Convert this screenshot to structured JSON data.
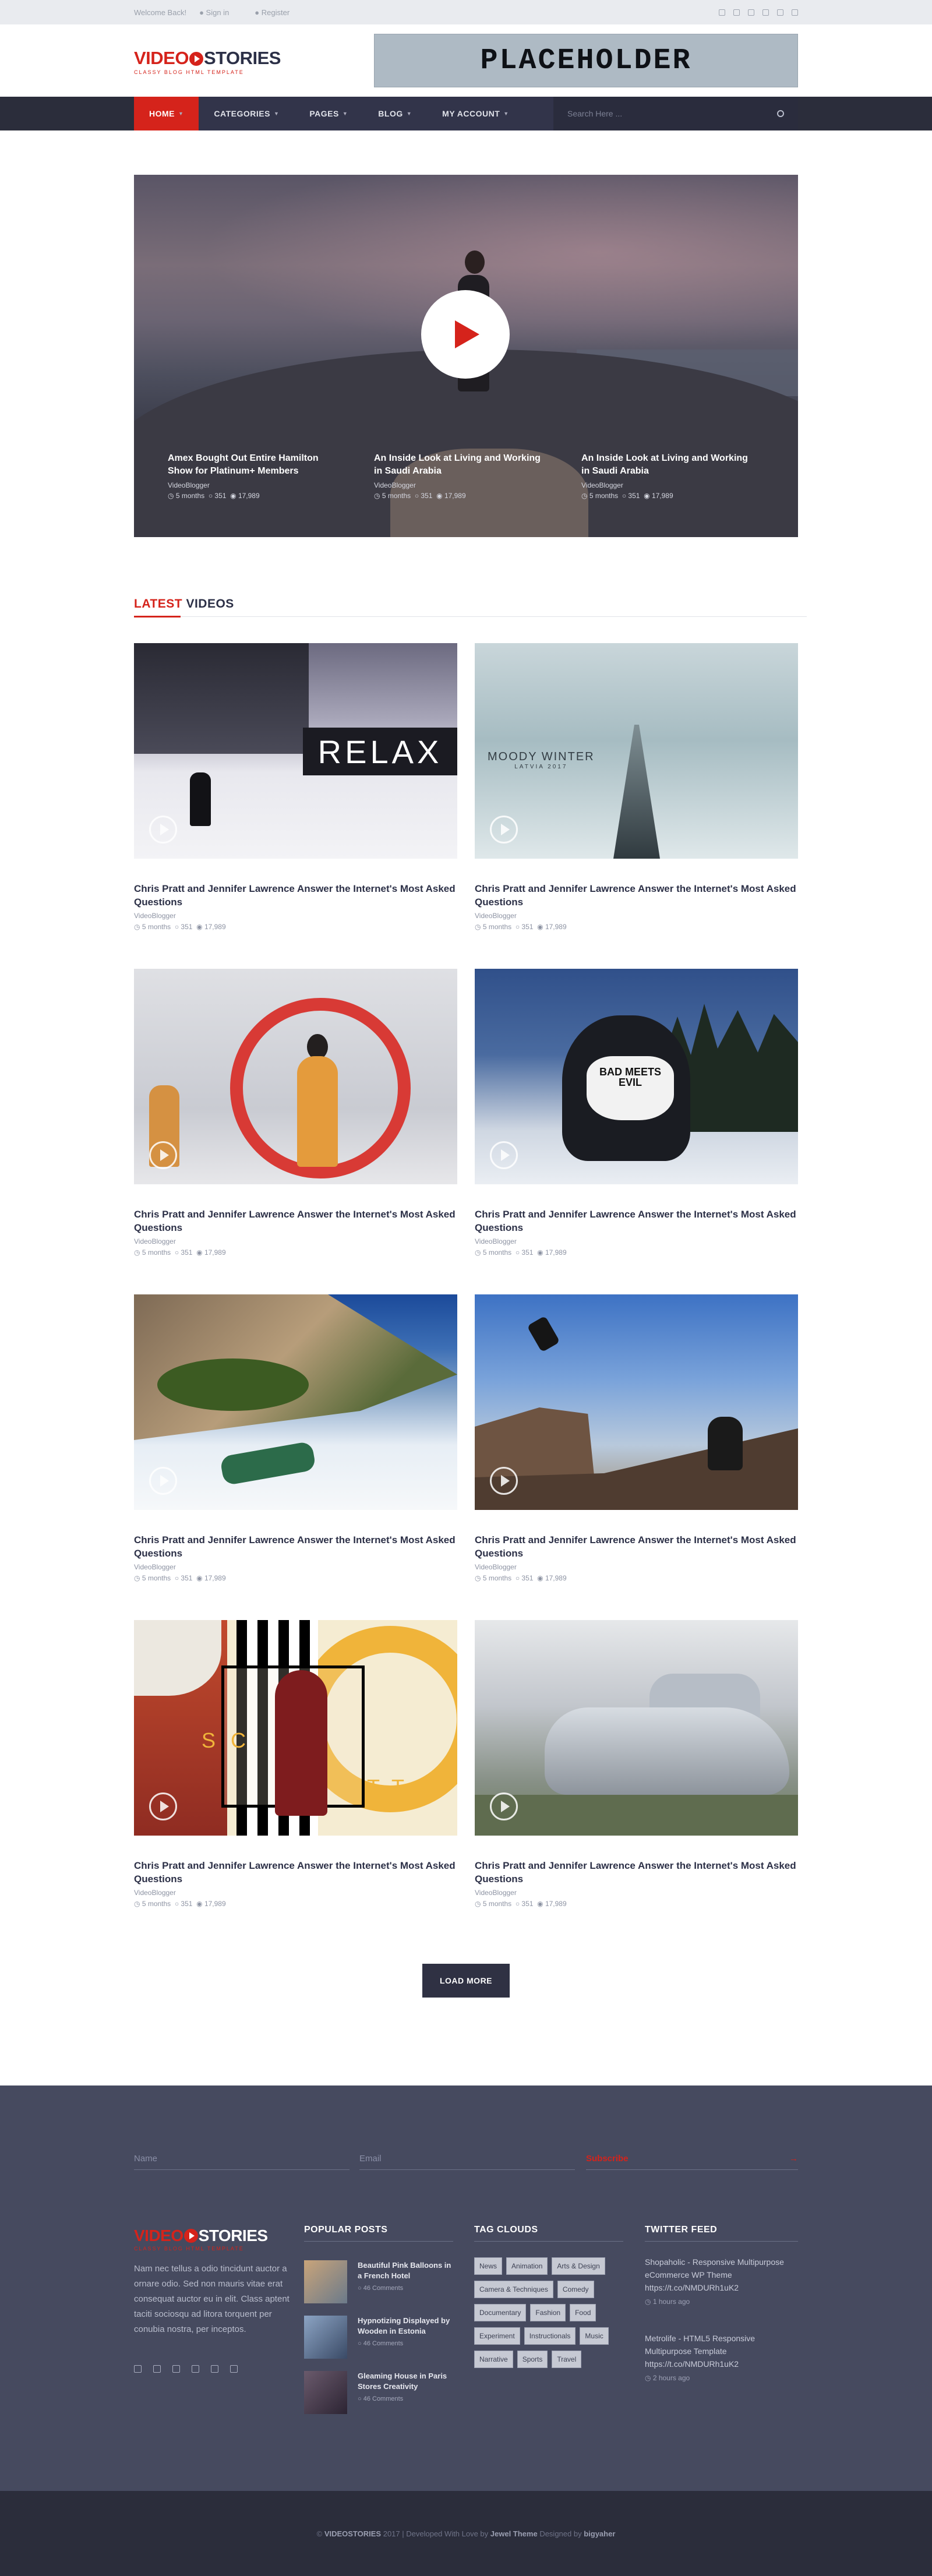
{
  "topbar": {
    "welcome": "Welcome Back!",
    "signin": "Sign in",
    "register": "Register",
    "social_icons": [
      "facebook-icon",
      "pinterest-icon",
      "twitter-icon",
      "google-plus-icon",
      "linkedin-icon",
      "youtube-icon"
    ]
  },
  "header": {
    "logo_video": "VIDEO",
    "logo_stories": "STORIES",
    "logo_tagline": "CLASSY BLOG HTML TEMPLATE",
    "banner_text": "PLACEHOLDER"
  },
  "nav": {
    "items": [
      {
        "label": "HOME",
        "active": true
      },
      {
        "label": "CATEGORIES"
      },
      {
        "label": "PAGES"
      },
      {
        "label": "BLOG"
      },
      {
        "label": "MY ACCOUNT"
      }
    ],
    "search_placeholder": "Search Here ..."
  },
  "hero": {
    "slides": [
      {
        "title": "Amex Bought Out Entire Hamilton Show for Platinum+ Members",
        "channel": "VideoBlogger",
        "time": "5 months",
        "comments": "351",
        "views": "17,989"
      },
      {
        "title": "An Inside Look at Living and Working in Saudi Arabia",
        "channel": "VideoBlogger",
        "time": "5 months",
        "comments": "351",
        "views": "17,989"
      },
      {
        "title": "An Inside Look at Living and Working in Saudi Arabia",
        "channel": "VideoBlogger",
        "time": "5 months",
        "comments": "351",
        "views": "17,989"
      }
    ]
  },
  "latest": {
    "title_red": "LATEST",
    "title_dark": "VIDEOS",
    "videos": [
      {
        "title": "Chris Pratt and Jennifer Lawrence Answer the Internet's Most Asked Questions",
        "channel": "VideoBlogger",
        "time": "5 months",
        "comments": "351",
        "views": "17,989",
        "overlay": "RELAX"
      },
      {
        "title": "Chris Pratt and Jennifer Lawrence Answer the Internet's Most Asked Questions",
        "channel": "VideoBlogger",
        "time": "5 months",
        "comments": "351",
        "views": "17,989",
        "overlay": "MOODY WINTER",
        "overlay_sub": "LATVIA 2017"
      },
      {
        "title": "Chris Pratt and Jennifer Lawrence Answer the Internet's Most Asked Questions",
        "channel": "VideoBlogger",
        "time": "5 months",
        "comments": "351",
        "views": "17,989"
      },
      {
        "title": "Chris Pratt and Jennifer Lawrence Answer the Internet's Most Asked Questions",
        "channel": "VideoBlogger",
        "time": "5 months",
        "comments": "351",
        "views": "17,989",
        "overlay": "BAD MEETS EVIL"
      },
      {
        "title": "Chris Pratt and Jennifer Lawrence Answer the Internet's Most Asked Questions",
        "channel": "VideoBlogger",
        "time": "5 months",
        "comments": "351",
        "views": "17,989"
      },
      {
        "title": "Chris Pratt and Jennifer Lawrence Answer the Internet's Most Asked Questions",
        "channel": "VideoBlogger",
        "time": "5 months",
        "comments": "351",
        "views": "17,989"
      },
      {
        "title": "Chris Pratt and Jennifer Lawrence Answer the Internet's Most Asked Questions",
        "channel": "VideoBlogger",
        "time": "5 months",
        "comments": "351",
        "views": "17,989",
        "overlay": "SC",
        "overlay2": "TT"
      },
      {
        "title": "Chris Pratt and Jennifer Lawrence Answer the Internet's Most Asked Questions",
        "channel": "VideoBlogger",
        "time": "5 months",
        "comments": "351",
        "views": "17,989"
      }
    ],
    "load_more": "LOAD MORE"
  },
  "footer": {
    "subscribe": {
      "name_placeholder": "Name",
      "email_placeholder": "Email",
      "button": "Subscribe",
      "arrow": "→"
    },
    "about": "Nam nec tellus a odio tincidunt auctor a ornare odio. Sed non mauris vitae erat consequat auctor eu in elit. Class aptent taciti sociosqu ad litora torquent per conubia nostra, per inceptos.",
    "footer_social_icons": [
      "facebook-icon",
      "twitter-icon",
      "pinterest-icon",
      "linkedin-icon",
      "google-plus-icon",
      "youtube-icon"
    ],
    "popular_title": "POPULAR POSTS",
    "popular": [
      {
        "title": "Beautiful Pink Balloons in a French Hotel",
        "comments": "46 Comments"
      },
      {
        "title": "Hypnotizing Displayed by Wooden in Estonia",
        "comments": "46 Comments"
      },
      {
        "title": "Gleaming House in Paris Stores Creativity",
        "comments": "46 Comments"
      }
    ],
    "tags_title": "TAG CLOUDS",
    "tags": [
      "News",
      "Animation",
      "Arts & Design",
      "Camera & Techniques",
      "Comedy",
      "Documentary",
      "Fashion",
      "Food",
      "Experiment",
      "Instructionals",
      "Music",
      "Narrative",
      "Sports",
      "Travel"
    ],
    "twitter_title": "TWITTER FEED",
    "tweets": [
      {
        "text": "Shopaholic - Responsive Multipurpose eCommerce WP Theme https://t.co/NMDURh1uK2",
        "time": "1 hours ago"
      },
      {
        "text": "Metrolife - HTML5 Responsive Multipurpose Template https://t.co/NMDURh1uK2",
        "time": "2 hours ago"
      }
    ],
    "copyright": {
      "prefix": "© ",
      "brand": "VIDEOSTORIES",
      "mid": " 2017 | Developed With Love by ",
      "dev": "Jewel Theme",
      "mid2": " Designed by ",
      "designer": "bigyaher"
    }
  },
  "colors": {
    "accent": "#d5231b",
    "nav_bg": "#32344a",
    "footer_bg": "#464a5f"
  }
}
